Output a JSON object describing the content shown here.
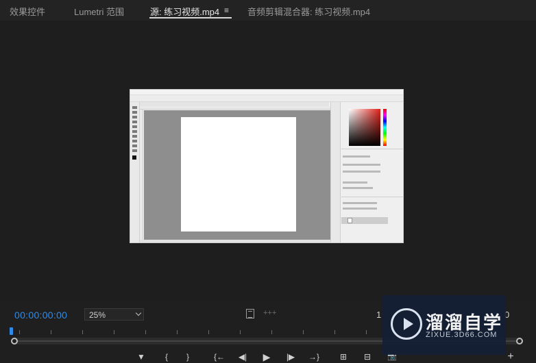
{
  "tabs": [
    {
      "label": "效果控件",
      "active": false
    },
    {
      "label": "Lumetri 范围",
      "active": false
    },
    {
      "label": "源: 练习视频.mp4",
      "active": true
    },
    {
      "label": "音频剪辑混合器: 练习视频.mp4",
      "active": false
    }
  ],
  "tab_menu_glyph": "≡",
  "controls": {
    "timecode": "00:00:00:00",
    "zoom_value": "25%",
    "right_timecode_partial": "1",
    "right_timecode_tail": "0"
  },
  "transport": {
    "marker_glyph": "▼",
    "in_glyph": "{",
    "out_glyph": "}",
    "goto_in_glyph": "{←",
    "step_back_glyph": "◀|",
    "play_glyph": "▶",
    "step_fwd_glyph": "|▶",
    "goto_out_glyph": "→}",
    "insert_glyph": "⊞",
    "overwrite_glyph": "⊟",
    "export_frame_glyph": "📷",
    "add_glyph": "+"
  },
  "watermark": {
    "title": "溜溜自学",
    "url": "ZIXUE.3D66.COM"
  },
  "colors": {
    "accent_blue": "#2d8ceb",
    "panel_bg": "#1e1e1e"
  },
  "icons": {
    "fit": "fit-frame-icon",
    "marker": "marker-icon",
    "camera": "export-frame-icon"
  }
}
